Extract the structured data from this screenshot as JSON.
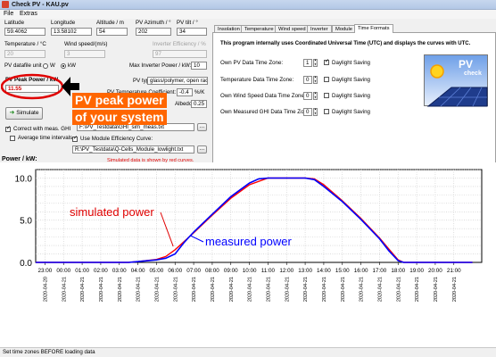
{
  "window": {
    "title": "Check PV - KAU.pv"
  },
  "menu": {
    "file": "File",
    "extras": "Extras"
  },
  "location": {
    "latitude_label": "Latitude",
    "latitude_value": "59.4062",
    "longitude_label": "Longitude",
    "longitude_value": "13.58102",
    "altitude_label": "Altitude / m",
    "altitude_value": "54",
    "pv_azimuth_label": "PV Azimuth / °",
    "pv_azimuth_value": "202",
    "pv_tilt_label": "PV tilt / °",
    "pv_tilt_value": "34"
  },
  "weather": {
    "temperature_label": "Temperature / °C",
    "temperature_value": "20",
    "wind_speed_label": "Wind speed/(m/s)",
    "wind_speed_value": "3",
    "inverter_eff_label": "Inverter Efficiency / %",
    "inverter_eff_value": "97"
  },
  "units": {
    "label": "PV datafile unit",
    "option_w": "W",
    "option_kw": "kW",
    "selected": "kW"
  },
  "max_inverter": {
    "label": "Max Inverter Power / kW:",
    "value": "10"
  },
  "pv_peak": {
    "label": "PV Peak Power / kW",
    "value": "11.55"
  },
  "pv_type": {
    "label": "PV type:",
    "value": "glass/polymer,  open rack"
  },
  "temp_coeff": {
    "label": "PV Temperature Coefficient:",
    "value": "-0.4",
    "unit": "%/K"
  },
  "albedo": {
    "label": "Albedo:",
    "value": "0.25"
  },
  "simulate_button": "Simulate",
  "ghi": {
    "checkbox_label": "Correct with meas. GHI",
    "checked": true,
    "file": "F:\\PV_Testdata\\GHI_sim_meas.txt"
  },
  "avg_intervals": {
    "label": "Average time intervals",
    "checked": false
  },
  "module_eff": {
    "label": "Use Module Efficiency Curve:",
    "checked": true,
    "file": "R:\\PV_Testdata\\Q-Cells_Module_lowlight.txt"
  },
  "browse_button": "...",
  "sim_note": "Simulated data is shown by red curves.",
  "tabs": [
    "Insolation",
    "Temperature",
    "Wind speed",
    "Inverter",
    "Module",
    "Time Formats"
  ],
  "active_tab": "Time Formats",
  "time_formats": {
    "info": "This program internally uses Coordinated Universal Time (UTC) and displays the curves with UTC.",
    "rows": [
      {
        "label": "Own PV Data Time Zone:",
        "value": "1",
        "dst_label": "Daylight Saving",
        "dst": true
      },
      {
        "label": "Temperature Data Time Zone:",
        "value": "0",
        "dst_label": "Daylight Saving",
        "dst": false
      },
      {
        "label": "Own Wind Speed Data Time Zone:",
        "value": "0",
        "dst_label": "Daylight Saving",
        "dst": false
      },
      {
        "label": "Own Measured GHI Data Time Zone:",
        "value": "0",
        "dst_label": "Daylight Saving",
        "dst": false
      }
    ]
  },
  "logo": {
    "line1": "PV",
    "line2": "check"
  },
  "annotations": {
    "peak_line1": "PV peak power",
    "peak_line2": "of your system",
    "simulated": "simulated power",
    "measured": "measured power"
  },
  "status": "Set time zones BEFORE loading data",
  "colors": {
    "simulated": "#ff0000",
    "measured": "#0000ff",
    "callout": "#ff6600",
    "annotation_red": "#e00000"
  },
  "chart_data": {
    "type": "line",
    "ylabel": "Power / kW:",
    "ylim": [
      0,
      11
    ],
    "yticks": [
      0.0,
      5.0,
      10.0
    ],
    "x": [
      "23:00",
      "00:00",
      "01:00",
      "02:00",
      "03:00",
      "04:00",
      "05:00",
      "06:00",
      "07:00",
      "08:00",
      "09:00",
      "10:00",
      "11:00",
      "12:00",
      "13:00",
      "14:00",
      "15:00",
      "16:00",
      "17:00",
      "18:00",
      "19:00",
      "20:00",
      "21:00"
    ],
    "x_dates": [
      "2020-04-20",
      "2020-04-21",
      "2020-04-21",
      "2020-04-21",
      "2020-04-21",
      "2020-04-21",
      "2020-04-21",
      "2020-04-21",
      "2020-04-21",
      "2020-04-21",
      "2020-04-21",
      "2020-04-21",
      "2020-04-21",
      "2020-04-21",
      "2020-04-21",
      "2020-04-21",
      "2020-04-21",
      "2020-04-21",
      "2020-04-21",
      "2020-04-21",
      "2020-04-21",
      "2020-04-21",
      "2020-04-21"
    ],
    "grid": true,
    "series": [
      {
        "name": "simulated power",
        "color": "#ff0000",
        "points": [
          [
            -1.5,
            0
          ],
          [
            3.5,
            0
          ],
          [
            4,
            0.1
          ],
          [
            5,
            0.35
          ],
          [
            5.5,
            0.7
          ],
          [
            6,
            1.5
          ],
          [
            7,
            3.5
          ],
          [
            8,
            5.6
          ],
          [
            9,
            7.6
          ],
          [
            10,
            9.2
          ],
          [
            11,
            10
          ],
          [
            12,
            10
          ],
          [
            13,
            10
          ],
          [
            13.5,
            9.9
          ],
          [
            14,
            9.2
          ],
          [
            15,
            7.3
          ],
          [
            16,
            5.2
          ],
          [
            17,
            2.9
          ],
          [
            17.5,
            1.6
          ],
          [
            18,
            0.3
          ],
          [
            18.3,
            0
          ],
          [
            22,
            0
          ]
        ]
      },
      {
        "name": "measured power",
        "color": "#0000ff",
        "points": [
          [
            -1.5,
            0
          ],
          [
            3.5,
            0
          ],
          [
            4,
            0.1
          ],
          [
            5,
            0.3
          ],
          [
            5.5,
            0.5
          ],
          [
            6,
            1.0
          ],
          [
            6.5,
            2.4
          ],
          [
            7,
            3.6
          ],
          [
            8,
            5.7
          ],
          [
            9,
            7.8
          ],
          [
            10,
            9.4
          ],
          [
            10.5,
            9.9
          ],
          [
            11,
            10
          ],
          [
            12,
            10
          ],
          [
            13,
            10
          ],
          [
            13.5,
            9.8
          ],
          [
            14,
            9.0
          ],
          [
            15,
            7.2
          ],
          [
            16,
            5.1
          ],
          [
            17,
            2.8
          ],
          [
            17.5,
            1.4
          ],
          [
            18,
            0.2
          ],
          [
            18.3,
            0
          ],
          [
            22,
            0
          ]
        ]
      }
    ]
  }
}
